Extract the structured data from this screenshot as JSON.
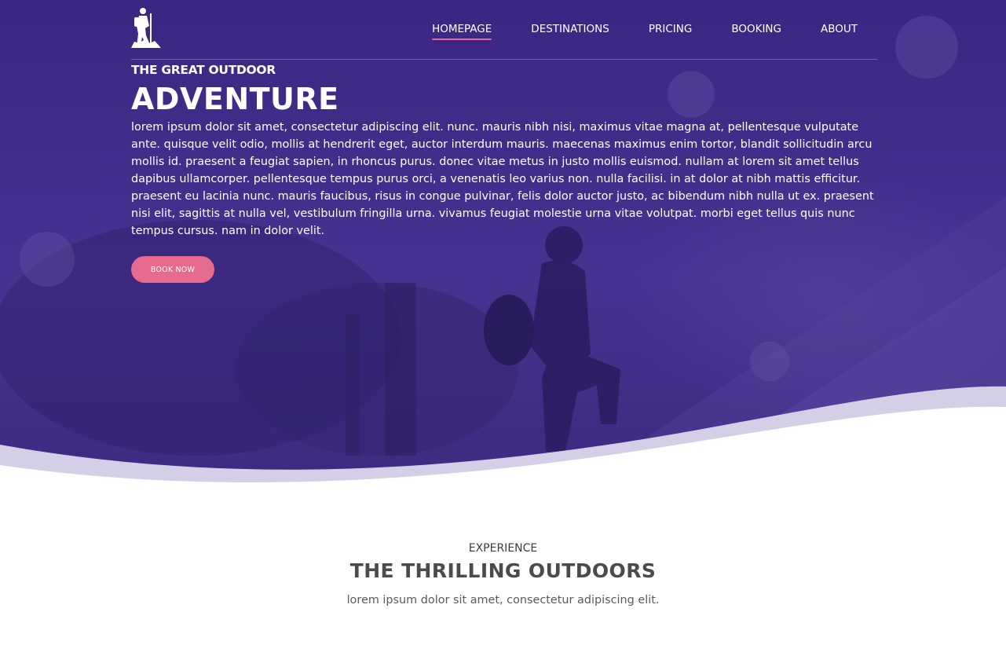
{
  "nav": {
    "items": [
      {
        "label": "HOMEPAGE",
        "active": true
      },
      {
        "label": "DESTINATIONS",
        "active": false
      },
      {
        "label": "PRICING",
        "active": false
      },
      {
        "label": "BOOKING",
        "active": false
      },
      {
        "label": "ABOUT",
        "active": false
      }
    ]
  },
  "hero": {
    "pre_title": "THE GREAT OUTDOOR",
    "title": "ADVENTURE",
    "text": "lorem ipsum dolor sit amet, consectetur adipiscing elit. nunc. mauris nibh nisi, maximus vitae magna at, pellentesque vulputate ante. quisque velit odio, mollis at hendrerit eget, auctor interdum mauris. maecenas maximus enim tortor, blandit sollicitudin arcu mollis id. praesent a feugiat sapien, in rhoncus purus. donec vitae metus in justo mollis euismod. nullam at lorem sit amet tellus dapibus ullamcorper. pellentesque tempus purus orci, a venenatis leo varius non. nulla facilisi. in at dolor at nibh mattis efficitur. praesent eu lacinia nunc. mauris faucibus, risus in congue pulvinar, felis dolor auctor justo, ac bibendum nibh nulla ut ex. praesent nisi elit, sagittis at nulla vel, vestibulum fringilla urna. vivamus feugiat molestie urna vitae volutpat. morbi eget tellus quis nunc tempus cursus. nam in dolor velit.",
    "button_label": "BOOK NOW"
  },
  "section": {
    "eyebrow": "EXPERIENCE",
    "title": "THE THRILLING OUTDOORS",
    "subtitle": "lorem ipsum dolor sit amet, consectetur adipiscing elit."
  },
  "colors": {
    "hero_overlay": "#3d2a86",
    "accent": "#e66a8e",
    "wave_light": "#d4cfe6"
  },
  "icons": {
    "logo": "hiker-icon"
  }
}
